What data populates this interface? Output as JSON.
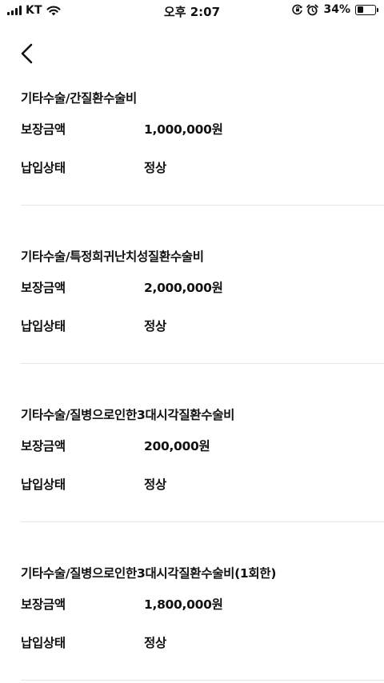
{
  "status_bar": {
    "carrier": "KT",
    "time": "오후 2:07",
    "battery_percent": "34%",
    "battery_level": 0.34
  },
  "labels": {
    "coverage_amount": "보장금액",
    "payment_status": "납입상태"
  },
  "items": [
    {
      "title": "기타수술/간질환수술비",
      "amount": "1,000,000원",
      "status": "정상"
    },
    {
      "title": "기타수술/특정희귀난치성질환수술비",
      "amount": "2,000,000원",
      "status": "정상"
    },
    {
      "title": "기타수술/질병으로인한3대시각질환수술비",
      "amount": "200,000원",
      "status": "정상"
    },
    {
      "title": "기타수술/질병으로인한3대시각질환수술비(1회한)",
      "amount": "1,800,000원",
      "status": "정상"
    }
  ]
}
